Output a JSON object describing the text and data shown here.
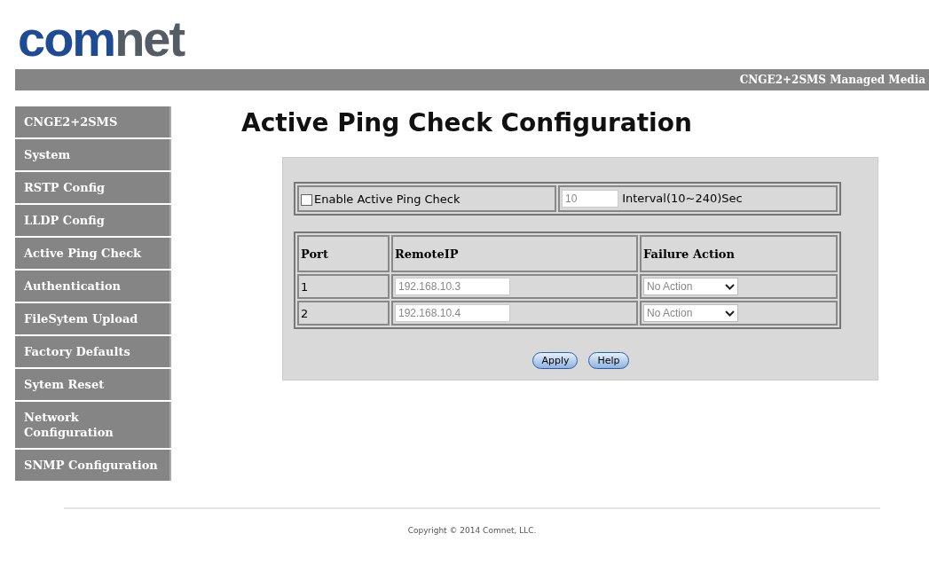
{
  "logo": {
    "first": "com",
    "second": "net"
  },
  "header_bar": {
    "title": "CNGE2+2SMS Managed Media"
  },
  "sidebar": {
    "items": [
      {
        "label": "CNGE2+2SMS",
        "selected": false
      },
      {
        "label": "System",
        "selected": false
      },
      {
        "label": "RSTP Config",
        "selected": false
      },
      {
        "label": "LLDP Config",
        "selected": false
      },
      {
        "label": "Active Ping Check",
        "selected": false
      },
      {
        "label": "Authentication",
        "selected": false
      },
      {
        "label": "FileSytem Upload",
        "selected": false
      },
      {
        "label": "Factory Defaults",
        "selected": false
      },
      {
        "label": "Sytem Reset",
        "selected": false
      },
      {
        "label": "Network Configuration",
        "selected": false
      },
      {
        "label": "SNMP Configuration",
        "selected": false
      }
    ]
  },
  "page_title": "Active Ping Check Configuration",
  "settings": {
    "enable_label": "Enable Active Ping Check",
    "enable_checked": false,
    "interval_value": "10",
    "interval_label": "Interval(10~240)Sec"
  },
  "table": {
    "columns": [
      "Port",
      "RemoteIP",
      "Failure Action"
    ],
    "rows": [
      {
        "port": "1",
        "remote_ip": "192.168.10.3",
        "failure_action": "No Action"
      },
      {
        "port": "2",
        "remote_ip": "192.168.10.4",
        "failure_action": "No Action"
      }
    ]
  },
  "buttons": [
    "Apply",
    "Help"
  ],
  "footer": "Copyright © 2014 Comnet, LLC."
}
